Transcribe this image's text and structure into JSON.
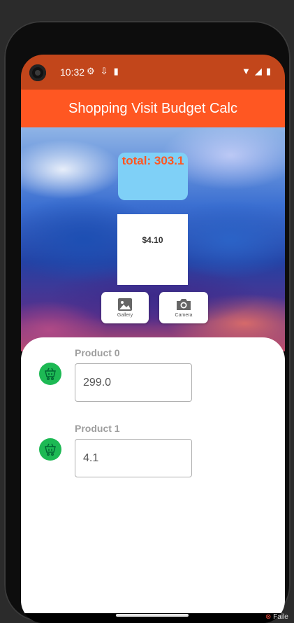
{
  "status_bar": {
    "time": "10:32",
    "left_icons": [
      "settings-icon",
      "download-icon",
      "sd-card-icon"
    ],
    "right_icons": [
      "wifi-icon",
      "signal-icon",
      "battery-icon"
    ]
  },
  "app_bar": {
    "title": "Shopping Visit Budget Calc"
  },
  "summary": {
    "total_label": "total: 303.1"
  },
  "receipt": {
    "price_text": "$4.10"
  },
  "actions": {
    "gallery_label": "Gallery",
    "camera_label": "Camera"
  },
  "products": [
    {
      "label": "Product 0",
      "value": "299.0",
      "icon": "shopping-cart-icon"
    },
    {
      "label": "Product 1",
      "value": "4.1",
      "icon": "shopping-cart-icon"
    }
  ],
  "colors": {
    "status_bar": "#c2461b",
    "app_bar": "#ff5722",
    "total_box": "#7fd0f7",
    "total_text": "#ff5722",
    "cart_icon_bg": "#1db954"
  },
  "host": {
    "error_fragment": "Faile"
  }
}
